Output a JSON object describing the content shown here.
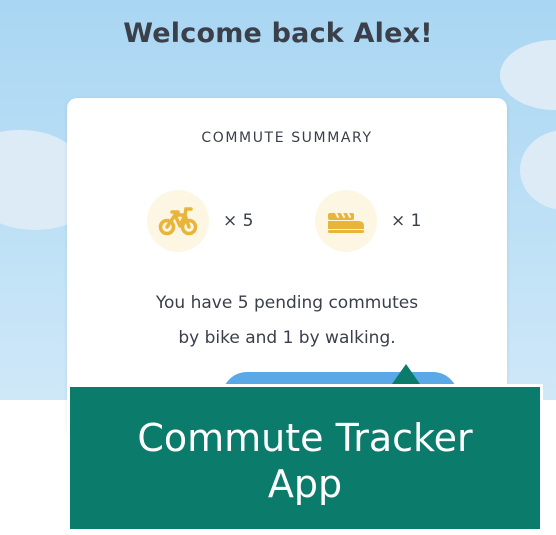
{
  "header": {
    "welcome": "Welcome back Alex!"
  },
  "summary": {
    "title": "COMMUTE SUMMARY",
    "modes": [
      {
        "icon": "bike-icon",
        "count": "× 5"
      },
      {
        "icon": "walking-icon",
        "count": "× 1"
      }
    ],
    "message_line1": "You have 5 pending commutes",
    "message_line2": "by bike and 1 by walking."
  },
  "caption": {
    "line1": "Commute Tracker",
    "line2": "App"
  },
  "colors": {
    "sky": "#a9d6f3",
    "icon_gold": "#e9b43a",
    "icon_bg": "#fdf6e3",
    "button_blue": "#5aa8e6",
    "caption_green": "#0b7c6c",
    "text_dark": "#3a3f4a"
  }
}
